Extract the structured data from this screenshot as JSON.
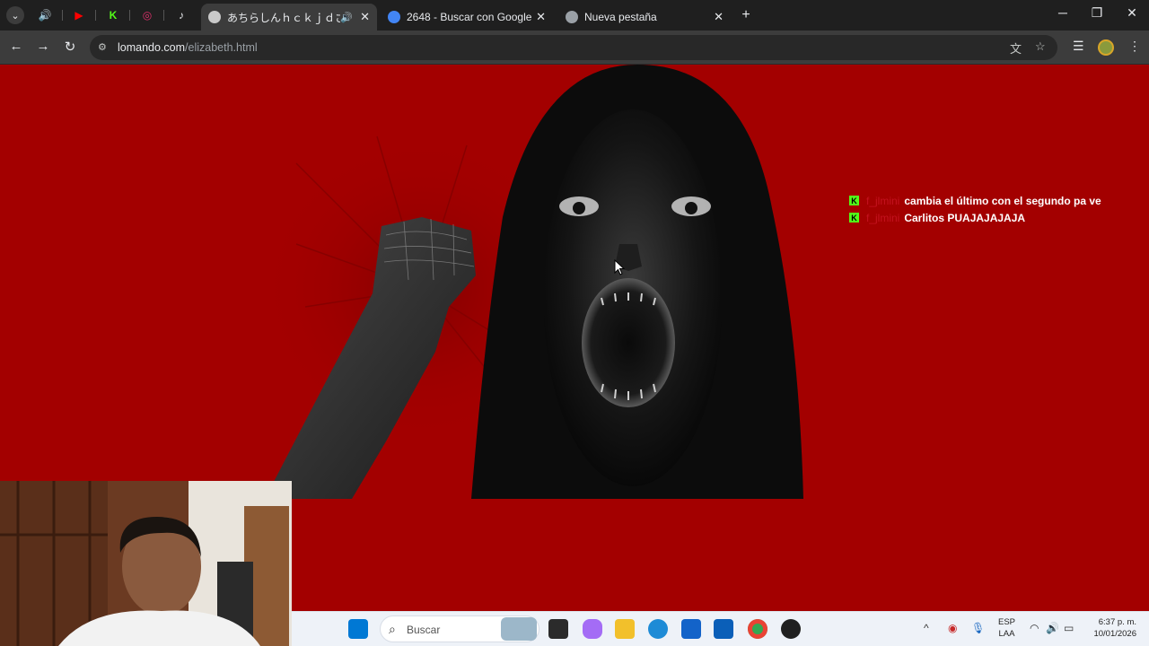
{
  "tabs": {
    "search_tabs_icon": "chevron-down-icon",
    "pinned": [
      {
        "icon": "speaker-icon",
        "glyph": "🔊"
      },
      {
        "icon": "youtube-icon",
        "glyph": "▶"
      },
      {
        "icon": "kick-icon",
        "glyph": "K"
      },
      {
        "icon": "instagram-icon",
        "glyph": "◎"
      },
      {
        "icon": "tiktok-icon",
        "glyph": "♪"
      }
    ],
    "items": [
      {
        "title": "あちらしんｈｃｋｊｄさ",
        "audio": "🔊",
        "active": true,
        "fav": "#c9c9c9"
      },
      {
        "title": "2648 - Buscar con Google",
        "audio": "",
        "active": false,
        "fav": "#4285f4"
      },
      {
        "title": "Nueva pestaña",
        "audio": "",
        "active": false,
        "fav": "#9aa0a6"
      }
    ],
    "close_glyph": "✕",
    "new_tab_glyph": "+"
  },
  "window": {
    "minimize": "─",
    "maximize": "❐",
    "close": "✕"
  },
  "toolbar": {
    "back": "←",
    "forward": "→",
    "reload": "↻",
    "url_host": "lomando.com",
    "url_path": "/elizabeth.html",
    "site_info_glyph": "⚙",
    "translate_glyph": "文",
    "bookmark_glyph": "☆",
    "reading_list_glyph": "☰",
    "menu_glyph": "⋮"
  },
  "chat": {
    "badge": "K",
    "badge_color": "#53fc18",
    "username_color": "#c4121f",
    "messages": [
      {
        "user": "f_jlmini",
        "text": "cambia el último con el segundo pa ve"
      },
      {
        "user": "f_jlmini",
        "text": "Carlitos PUAJAJAJAJA"
      }
    ]
  },
  "page": {
    "background": "#a30000"
  },
  "taskbar": {
    "search_label": "Buscar",
    "search_glyph": "⌕",
    "language": "ESP",
    "layout": "LAA",
    "time": "6:37 p. m.",
    "date": "10/01/2026",
    "tray": [
      {
        "icon": "chevron-up-icon",
        "glyph": "^"
      },
      {
        "icon": "antivirus-icon",
        "glyph": "◉"
      },
      {
        "icon": "microphone-icon",
        "glyph": "🎙"
      },
      {
        "icon": "wifi-icon",
        "glyph": "◠"
      },
      {
        "icon": "volume-icon",
        "glyph": "🔊"
      },
      {
        "icon": "battery-icon",
        "glyph": "▭"
      }
    ]
  }
}
